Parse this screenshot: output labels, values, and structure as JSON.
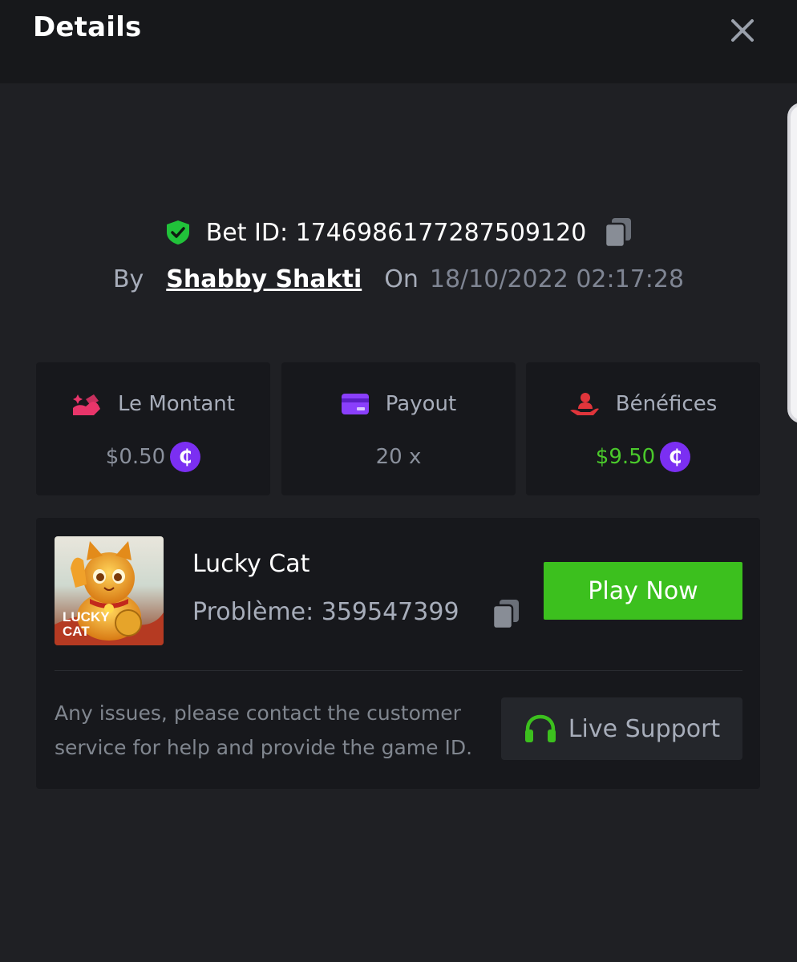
{
  "header": {
    "title": "Details",
    "close_icon": "close-icon"
  },
  "bet": {
    "id_text": "Bet ID: 1746986177287509120",
    "by_label": "By",
    "user": "Shabby Shakti",
    "on_label": "On",
    "datetime": "18/10/2022 02:17:28"
  },
  "stats": [
    {
      "label": "Le Montant",
      "value": "$0.50",
      "icon": "hand-coins-icon",
      "icon_color": "#e8356a",
      "has_coin": true,
      "value_color": "#8a909c"
    },
    {
      "label": "Payout",
      "value": "20 x",
      "icon": "card-icon",
      "icon_color": "#8a3ffc",
      "has_coin": false,
      "value_color": "#8a909c"
    },
    {
      "label": "Bénéfices",
      "value": "$9.50",
      "icon": "profit-hand-icon",
      "icon_color": "#e0353b",
      "has_coin": true,
      "value_color": "#4ac92b"
    }
  ],
  "coin_symbol": "₵",
  "game": {
    "name": "Lucky Cat",
    "problem": "Problème: 359547399",
    "play_label": "Play Now",
    "thumb_text": [
      "LUCKY",
      "CAT"
    ]
  },
  "support": {
    "help_text": "Any issues, please contact the customer service for help and provide the game ID.",
    "button_label": "Live Support"
  },
  "colors": {
    "accent_green": "#3cc01e",
    "coin_purple": "#7b2ff2",
    "background": "#1f2024",
    "panel": "#17181c"
  }
}
